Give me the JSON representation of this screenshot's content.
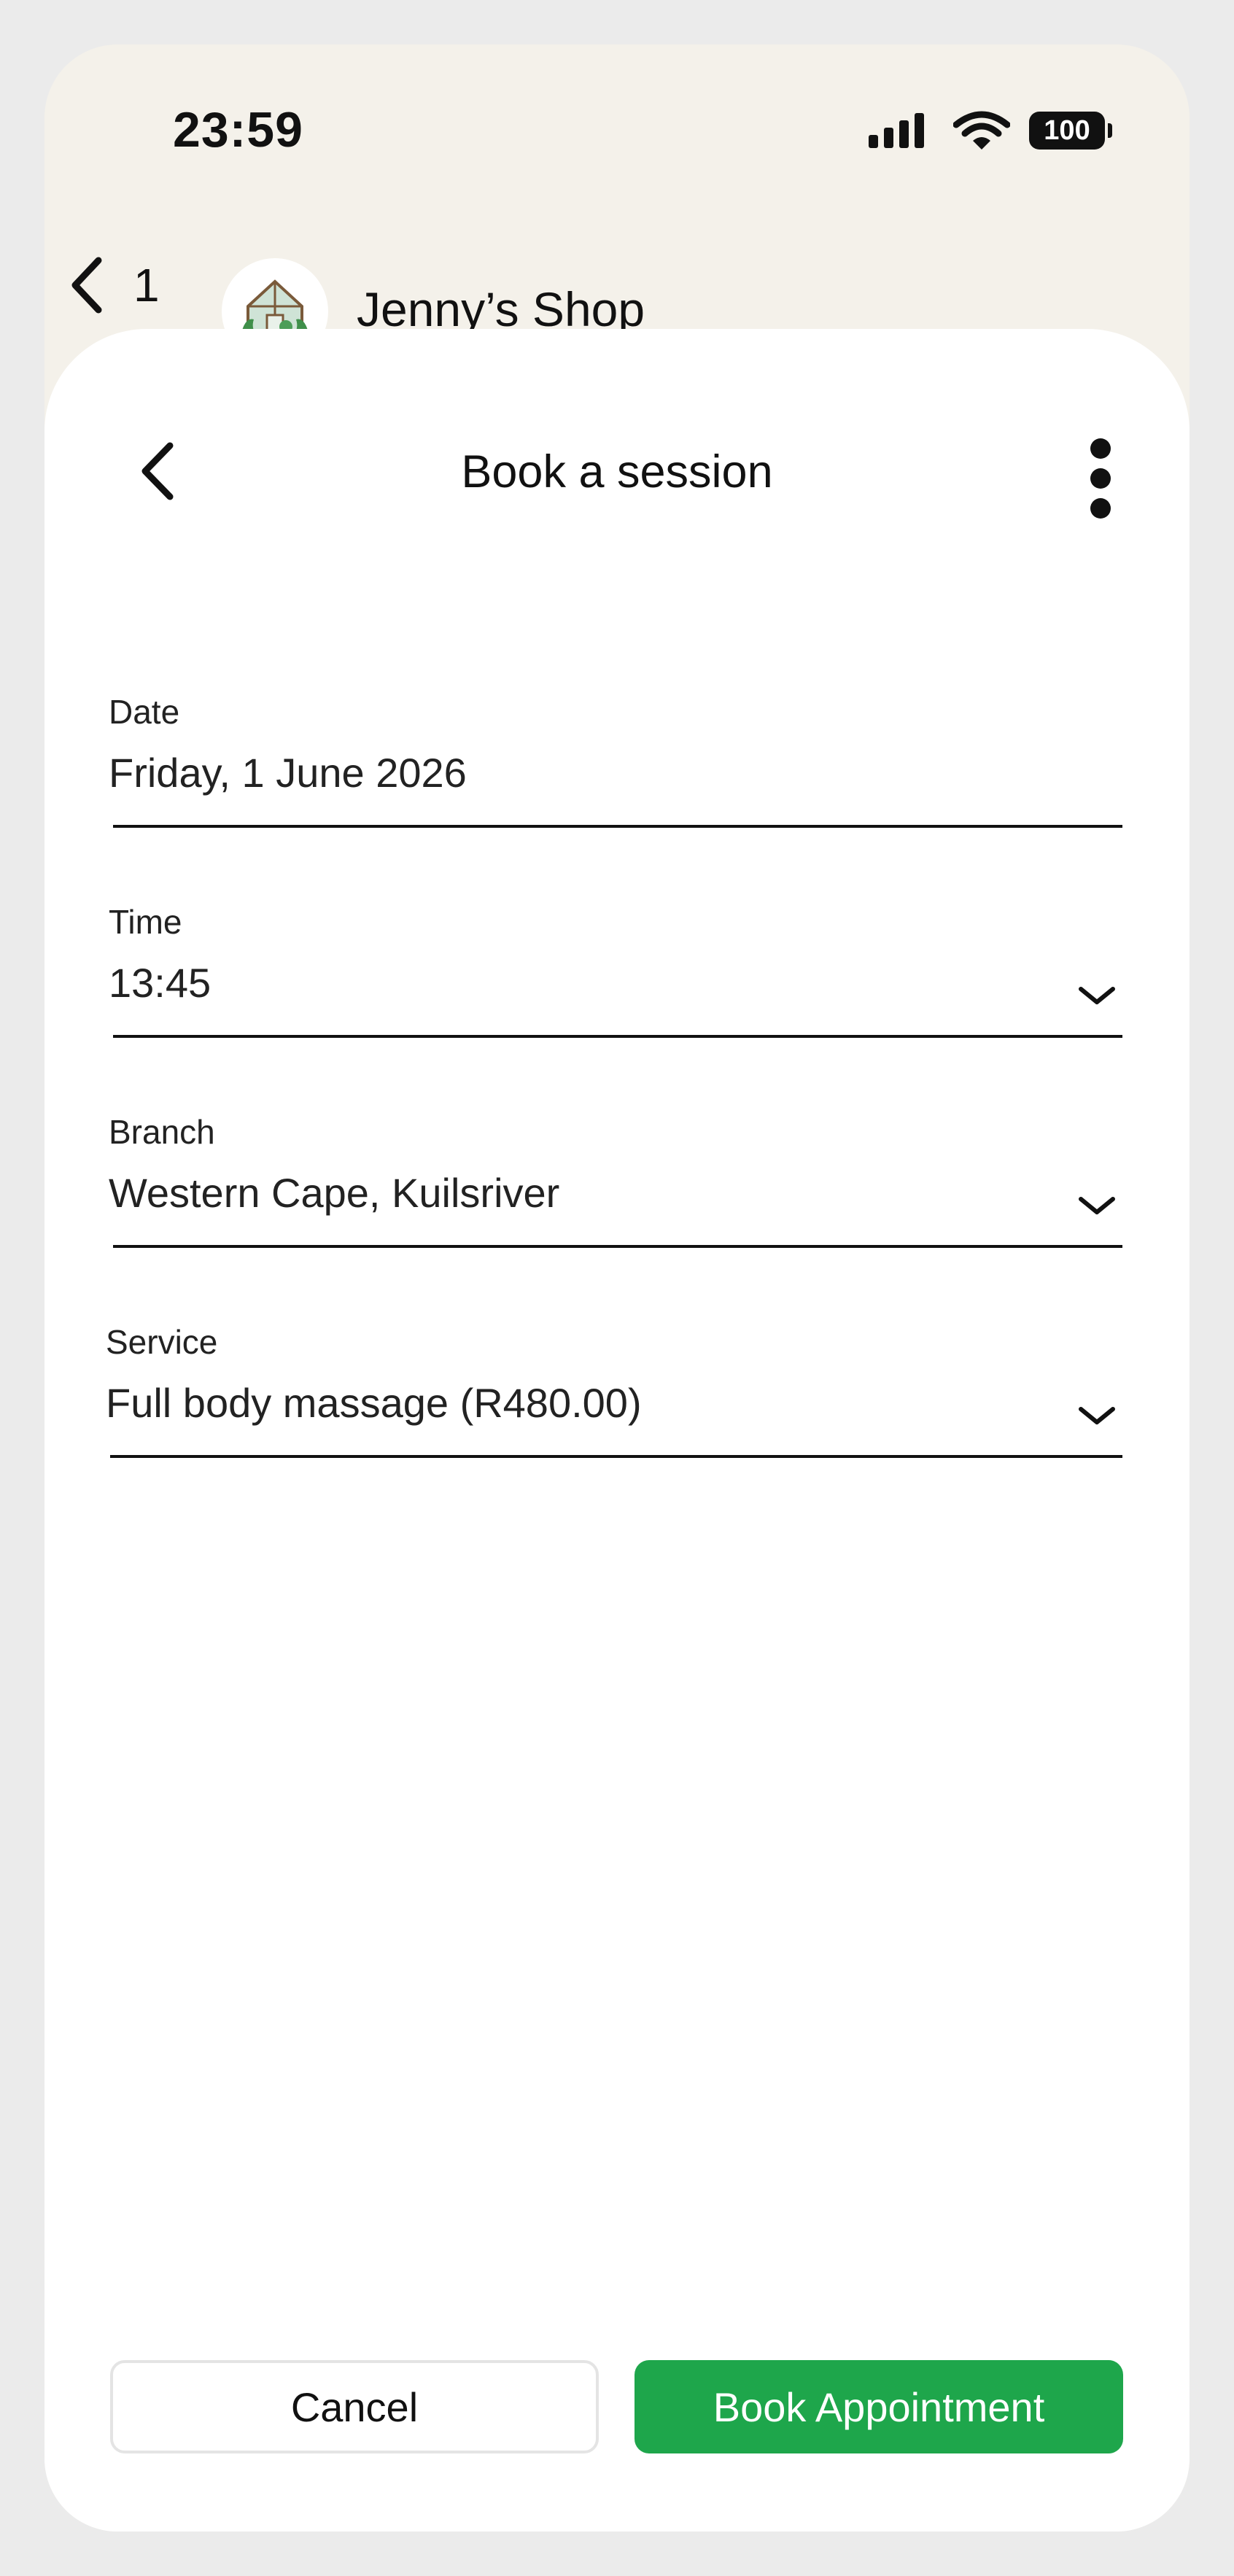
{
  "status_bar": {
    "time": "23:59",
    "battery": "100"
  },
  "chat_header": {
    "back_count": "1",
    "shop_name": "Jenny’s Shop"
  },
  "sheet": {
    "title": "Book a session",
    "fields": {
      "date": {
        "label": "Date",
        "value": "Friday, 1 June 2026"
      },
      "time": {
        "label": "Time",
        "value": "13:45"
      },
      "branch": {
        "label": "Branch",
        "value": "Western Cape, Kuilsriver"
      },
      "service": {
        "label": "Service",
        "value": "Full body massage (R480.00)"
      }
    },
    "buttons": {
      "cancel": "Cancel",
      "book": "Book Appointment"
    }
  },
  "colors": {
    "accent": "#1ea64b",
    "header_bg": "#f4f1ea",
    "frame": "#ebebeb"
  },
  "icons": [
    "signal-icon",
    "wifi-icon",
    "battery-icon",
    "back-chevron-icon",
    "shop-avatar-icon",
    "more-vertical-icon",
    "chevron-down-icon"
  ]
}
